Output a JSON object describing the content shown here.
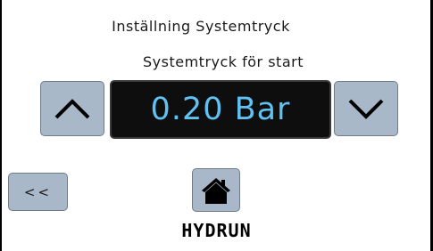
{
  "screen": {
    "title": "Inställning Systemtryck",
    "subtitle": "Systemtryck för start"
  },
  "pressure": {
    "value_text": "0.20 Bar",
    "value_color": "#5fc2f3",
    "increase_icon": "chevron-up-icon",
    "decrease_icon": "chevron-down-icon"
  },
  "navigation": {
    "back_label": "<<",
    "home_icon": "home-icon"
  },
  "brand": {
    "name": "HYDRUN"
  },
  "colors": {
    "button_fill": "#a9b8c8",
    "display_background": "#0e0e0e"
  }
}
